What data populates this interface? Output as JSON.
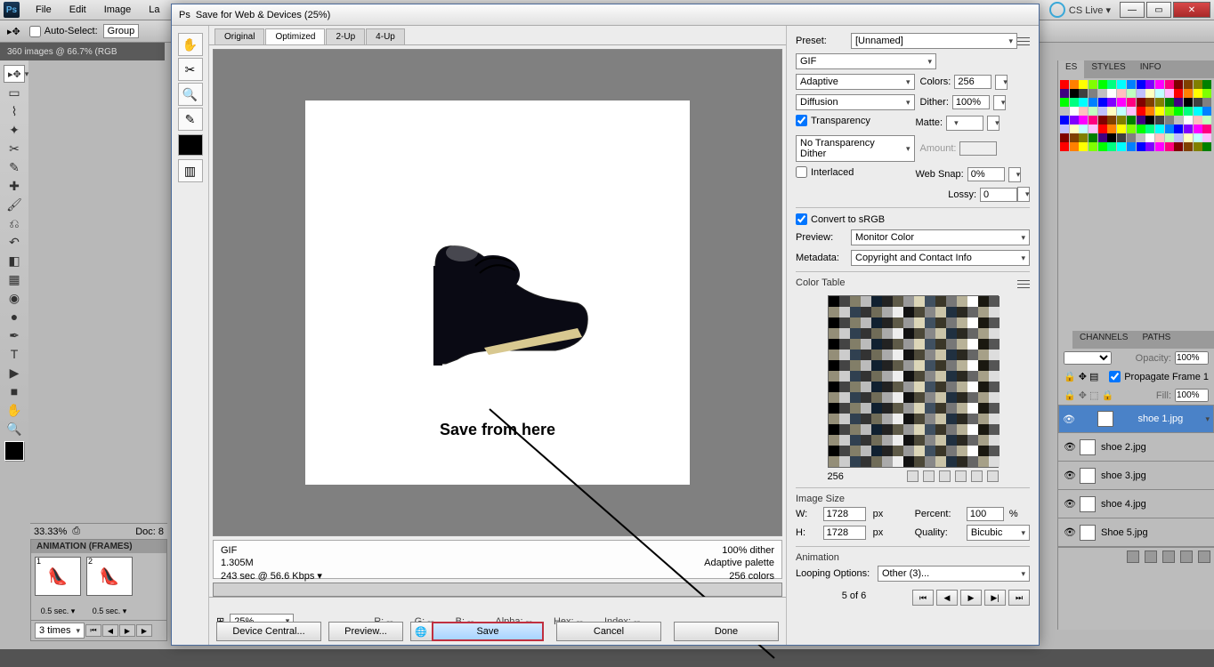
{
  "menubar": {
    "items": [
      "File",
      "Edit",
      "Image",
      "La"
    ],
    "cslive": "CS Live ▾"
  },
  "optionsbar": {
    "autoselect_label": "Auto-Select:",
    "autoselect_value": "Group"
  },
  "doctab": "360 images @ 66.7% (RGB",
  "bottomleft": {
    "zoom": "33.33%",
    "doc": "Doc: 8"
  },
  "animation_panel": {
    "title": "ANIMATION (FRAMES)",
    "frames": [
      {
        "n": "1",
        "sec": "0.5 sec. ▾"
      },
      {
        "n": "2",
        "sec": "0.5 sec. ▾"
      }
    ],
    "loop": "3 times"
  },
  "right_panels": {
    "swatch_tabs": [
      "ES",
      "STYLES",
      "INFO"
    ],
    "layer_tabs": [
      "",
      "CHANNELS",
      "PATHS"
    ],
    "opacity_label": "Opacity:",
    "opacity": "100%",
    "fill_label": "Fill:",
    "fill": "100%",
    "propagate": "Propagate Frame 1",
    "layers": [
      "shoe 1.jpg",
      "shoe 2.jpg",
      "shoe 3.jpg",
      "shoe 4.jpg",
      "Shoe 5.jpg"
    ]
  },
  "dialog": {
    "title": "Save for Web & Devices (25%)",
    "tabs": [
      "Original",
      "Optimized",
      "2-Up",
      "4-Up"
    ],
    "annotation": "Save from here",
    "info_left": {
      "l1": "GIF",
      "l2": "1.305M",
      "l3": "243 sec @ 56.6 Kbps ▾"
    },
    "info_right": {
      "l1": "100% dither",
      "l2": "Adaptive palette",
      "l3": "256 colors"
    },
    "zoom": "25%",
    "readouts": {
      "r": "R: --",
      "g": "G: --",
      "b": "B: --",
      "alpha": "Alpha: --",
      "hex": "Hex: --",
      "index": "Index: --"
    },
    "buttons": {
      "device": "Device Central...",
      "preview": "Preview...",
      "save": "Save",
      "cancel": "Cancel",
      "done": "Done"
    }
  },
  "settings": {
    "preset_label": "Preset:",
    "preset": "[Unnamed]",
    "format": "GIF",
    "reduction": "Adaptive",
    "colors_label": "Colors:",
    "colors": "256",
    "dither_method": "Diffusion",
    "dither_label": "Dither:",
    "dither": "100%",
    "transparency_label": "Transparency",
    "matte_label": "Matte:",
    "trans_dither": "No Transparency Dither",
    "amount_label": "Amount:",
    "interlaced_label": "Interlaced",
    "websnap_label": "Web Snap:",
    "websnap": "0%",
    "lossy_label": "Lossy:",
    "lossy": "0",
    "srgb_label": "Convert to sRGB",
    "preview_label": "Preview:",
    "preview": "Monitor Color",
    "metadata_label": "Metadata:",
    "metadata": "Copyright and Contact Info",
    "colortable_label": "Color Table",
    "ct_count": "256",
    "imagesize_label": "Image Size",
    "w_label": "W:",
    "w": "1728",
    "h_label": "H:",
    "h": "1728",
    "px": "px",
    "percent_label": "Percent:",
    "percent": "100",
    "pct": "%",
    "quality_label": "Quality:",
    "quality": "Bicubic",
    "anim_label": "Animation",
    "loop_label": "Looping Options:",
    "loop": "Other (3)...",
    "frame_of": "5 of 6"
  }
}
